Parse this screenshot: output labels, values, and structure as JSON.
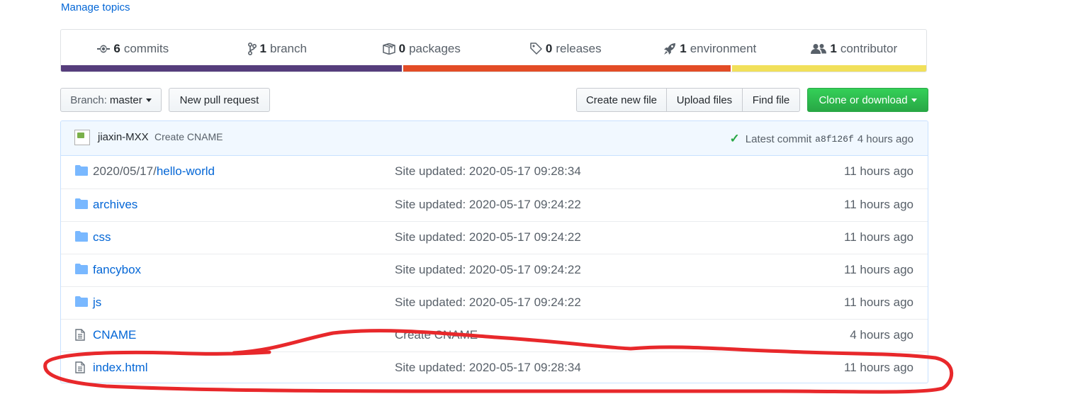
{
  "topics": {
    "manage_label": "Manage topics"
  },
  "summary": {
    "commits": {
      "count": "6",
      "label": "commits",
      "icon": "commit-icon"
    },
    "branch": {
      "count": "1",
      "label": "branch",
      "icon": "branch-icon"
    },
    "packages": {
      "count": "0",
      "label": "packages",
      "icon": "package-icon"
    },
    "releases": {
      "count": "0",
      "label": "releases",
      "icon": "tag-icon"
    },
    "environment": {
      "count": "1",
      "label": "environment",
      "icon": "rocket-icon"
    },
    "contributor": {
      "count": "1",
      "label": "contributor",
      "icon": "people-icon"
    }
  },
  "language_bar": [
    {
      "color": "#563d7c",
      "percent": 39.5
    },
    {
      "color": "#e34c26",
      "percent": 38.0
    },
    {
      "color": "#f1e05a",
      "percent": 22.5
    }
  ],
  "toolbar": {
    "branch_prefix": "Branch:",
    "branch_name": "master",
    "new_pr_label": "New pull request",
    "create_file_label": "Create new file",
    "upload_label": "Upload files",
    "find_file_label": "Find file",
    "clone_label": "Clone or download"
  },
  "latest_commit": {
    "author": "jiaxin-MXX",
    "message": "Create CNAME",
    "label": "Latest commit",
    "sha": "a8f126f",
    "age": "4 hours ago"
  },
  "files": [
    {
      "type": "folder",
      "prefix": "2020/05/17/",
      "name": "hello-world",
      "message": "Site updated: 2020-05-17 09:28:34",
      "age": "11 hours ago"
    },
    {
      "type": "folder",
      "prefix": "",
      "name": "archives",
      "message": "Site updated: 2020-05-17 09:24:22",
      "age": "11 hours ago"
    },
    {
      "type": "folder",
      "prefix": "",
      "name": "css",
      "message": "Site updated: 2020-05-17 09:24:22",
      "age": "11 hours ago"
    },
    {
      "type": "folder",
      "prefix": "",
      "name": "fancybox",
      "message": "Site updated: 2020-05-17 09:24:22",
      "age": "11 hours ago"
    },
    {
      "type": "folder",
      "prefix": "",
      "name": "js",
      "message": "Site updated: 2020-05-17 09:24:22",
      "age": "11 hours ago"
    },
    {
      "type": "file",
      "prefix": "",
      "name": "CNAME",
      "message": "Create CNAME",
      "age": "4 hours ago"
    },
    {
      "type": "file",
      "prefix": "",
      "name": "index.html",
      "message": "Site updated: 2020-05-17 09:28:34",
      "age": "11 hours ago"
    }
  ],
  "colors": {
    "link": "#0366d6",
    "annotation": "#e8282b",
    "clone_button": "#28a745"
  }
}
